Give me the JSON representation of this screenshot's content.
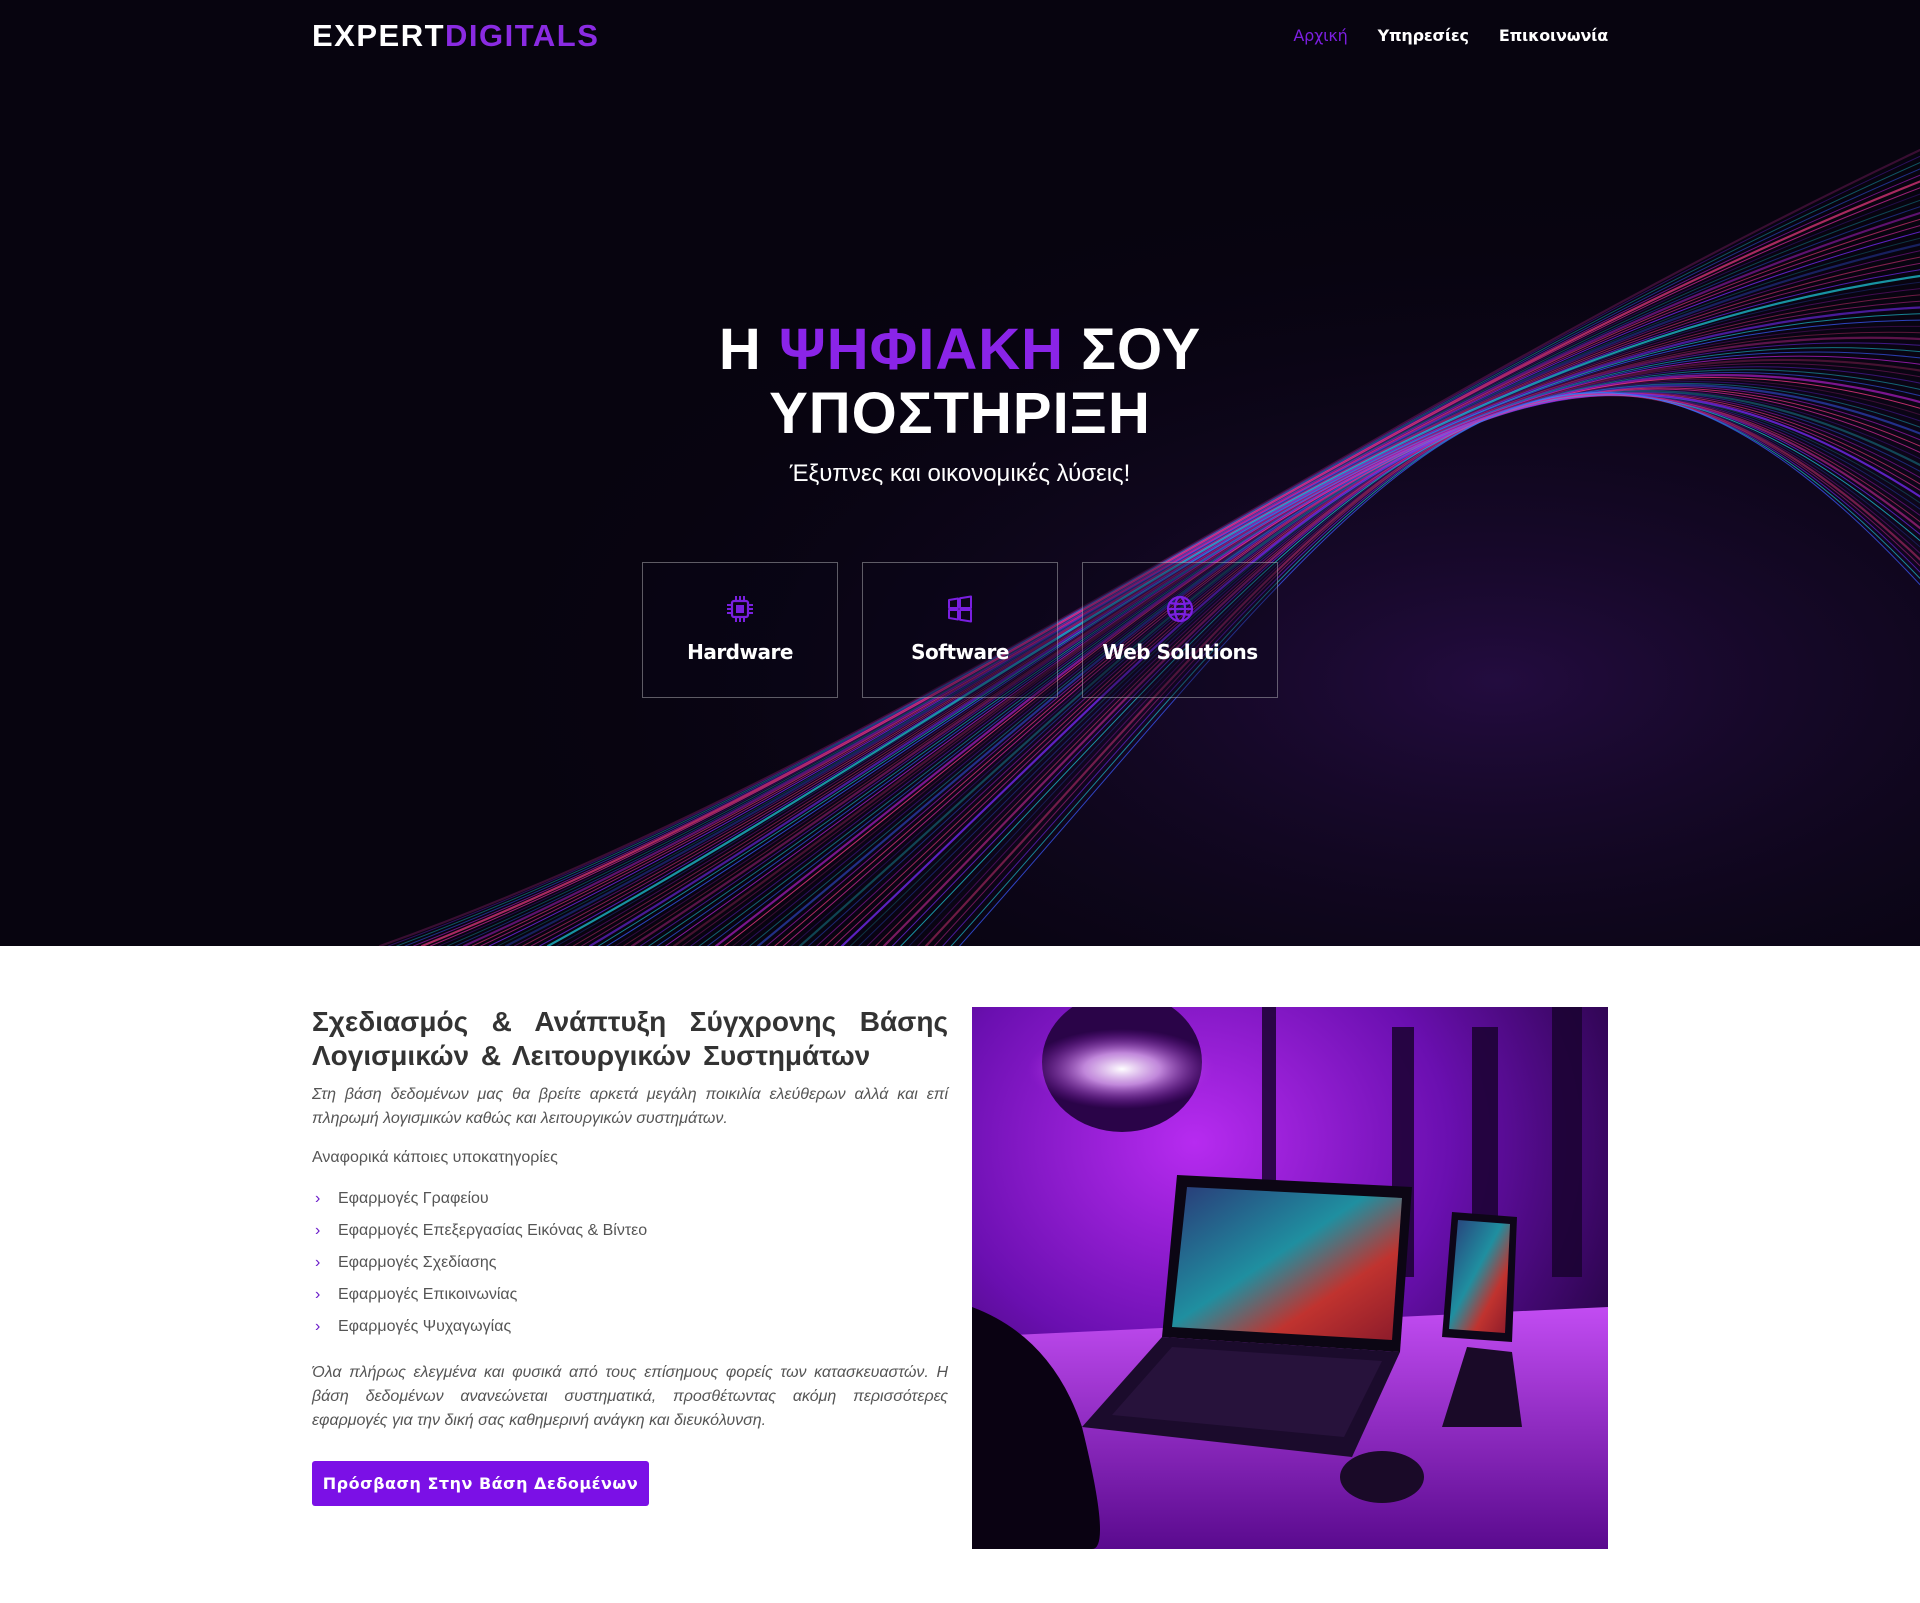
{
  "header": {
    "logo_main": "EXPERT",
    "logo_accent": "DIGITALS",
    "nav": [
      {
        "label": "Αρχική",
        "active": true
      },
      {
        "label": "Υπηρεσίες",
        "active": false
      },
      {
        "label": "Επικοινωνία",
        "active": false
      }
    ]
  },
  "hero": {
    "title_line1_prefix": "Η",
    "title_line1_accent": "ΨΗΦΙΑΚΗ",
    "title_line1_suffix": "ΣΟΥ",
    "title_line2": "ΥΠΟΣΤΗΡΙΞΗ",
    "subtitle": "Έξυπνες και οικονομικές λύσεις!",
    "cards": [
      {
        "label": "Hardware",
        "icon": "chip-icon"
      },
      {
        "label": "Software",
        "icon": "windows-icon"
      },
      {
        "label": "Web Solutions",
        "icon": "globe-icon"
      }
    ]
  },
  "content": {
    "title": "Σχεδιασμός & Ανάπτυξη Σύγχρονης Βάσης Λογισμικών & Λειτουργικών Συστημάτων",
    "intro": "Στη βάση δεδομένων μας θα βρείτε αρκετά μεγάλη ποικιλία ελεύθερων αλλά και επί πληρωμή λογισμικών καθώς και λειτουργικών συστημάτων.",
    "sub_heading": "Αναφορικά κάποιες υποκατηγορίες",
    "categories": [
      "Εφαρμογές Γραφείου",
      "Εφαρμογές Επεξεργασίας Εικόνας & Βίντεο",
      "Εφαρμογές Σχεδίασης",
      "Εφαρμογές Επικοινωνίας",
      "Εφαρμογές Ψυχαγωγίας"
    ],
    "outro": "Όλα πλήρως ελεγμένα και φυσικά από τους επίσημους φορείς των κατασκευαστών. Η βάση δεδομένων ανανεώνεται συστηματικά, προσθέτωντας ακόμη περισσότερες εφαρμογές για την δική σας καθημερινή ανάγκη και διευκόλυνση.",
    "cta_label": "Πρόσβαση Στην Βάση Δεδομένων"
  },
  "colors": {
    "accent": "#7b10e6",
    "hero_bg": "#07040f",
    "text": "#555555"
  }
}
